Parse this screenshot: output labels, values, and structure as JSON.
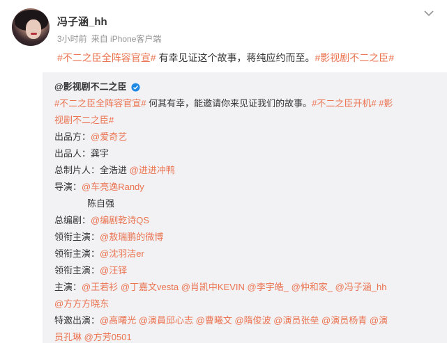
{
  "post": {
    "username": "冯子涵_hh",
    "time": "3小时前",
    "source": "来自 iPhone客户端",
    "text_tag1": "#不二之臣全阵容官宣#",
    "text_plain": " 有幸见证这个故事，蒋纯应约而至。",
    "text_tag2": "#影视剧不二之臣#"
  },
  "repost": {
    "author": "@影视剧不二之臣",
    "line1_tag1": "#不二之臣全阵容官宣#",
    "line1_plain": " 何其有幸，能邀请你来见证我们的故事。",
    "line1_tag2": "#不二之臣开机#",
    "line1_tag3": " #影",
    "line2_tag": "视剧不二之臣#",
    "credits": [
      {
        "label": "出品方：",
        "mentions": [
          "@爱奇艺"
        ],
        "plain": ""
      },
      {
        "label": "出品人：",
        "mentions": [],
        "plain": "龚宇"
      },
      {
        "label": "总制片人：",
        "plain": "全浩进 ",
        "mentions": [
          "@进进冲鸭"
        ]
      },
      {
        "label": "导演：",
        "mentions": [
          "@车亮逸Randy"
        ],
        "plain": ""
      }
    ],
    "director2": "陈自强",
    "credits2": [
      {
        "label": "总编剧：",
        "mentions": [
          "@编剧乾诗QS"
        ]
      },
      {
        "label": "领衔主演：",
        "mentions": [
          "@敖瑞鹏的微博"
        ]
      },
      {
        "label": "领衔主演：",
        "mentions": [
          "@沈羽洁er"
        ]
      },
      {
        "label": "领衔主演：",
        "mentions": [
          "@汪铎"
        ]
      }
    ],
    "cast_label": "主演：",
    "cast_line1": "@王若衫 @丁嘉文vesta @肖凯中KEVIN @李宇皓_ @仲和家_ @冯子涵_hh",
    "cast_line2": "@方方方晓东",
    "guest_label": "特邀出演：",
    "guest_line1": "@高曙光 @演員邱心志 @曹曦文 @隋俊波 @演员张垒 @演员杨青 @演",
    "guest_line2": "员孔琳 @方芳0501"
  },
  "colors": {
    "link": "#eb7350",
    "verified": "#1e88e5",
    "repost_bg": "#f2f2f5"
  },
  "icons": [
    "chevron-down-icon",
    "verified-icon"
  ]
}
